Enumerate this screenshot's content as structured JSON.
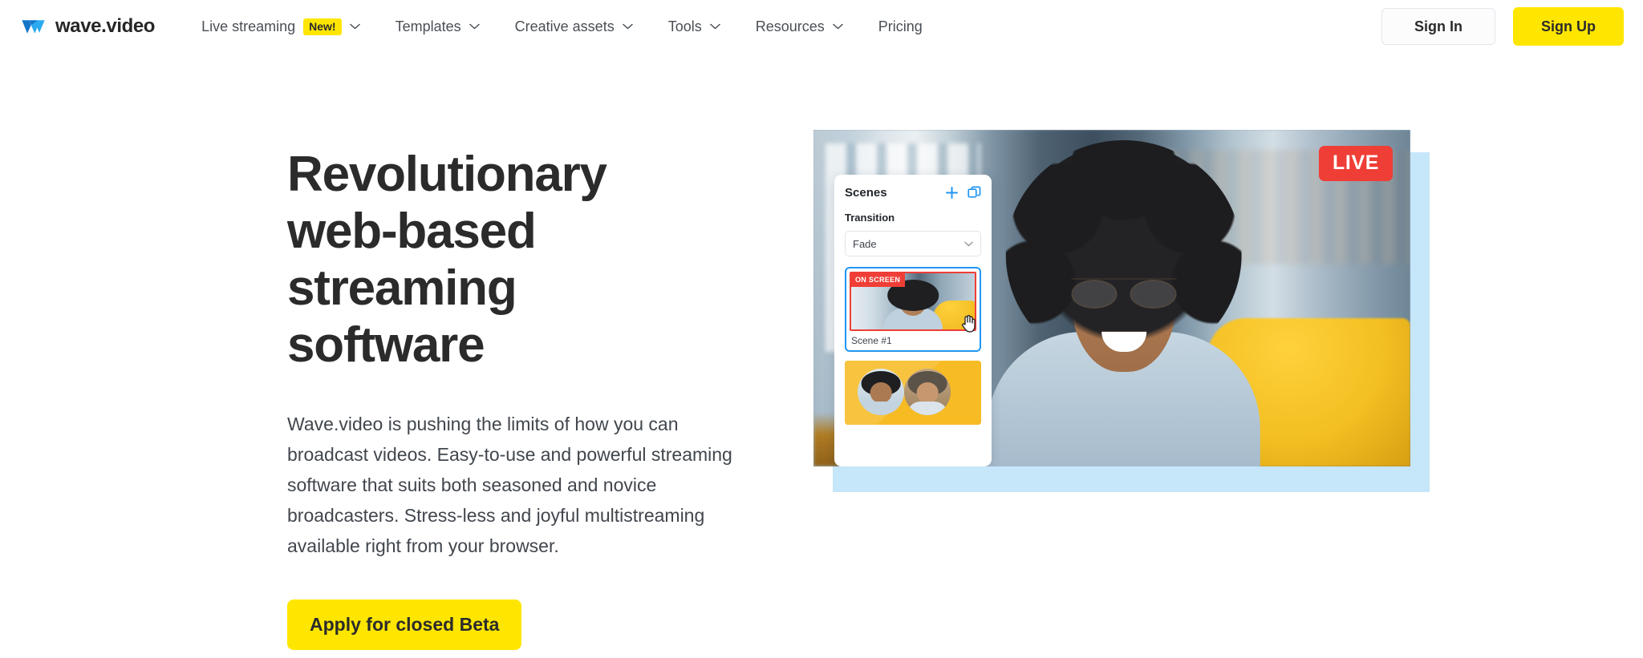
{
  "header": {
    "brand": {
      "name": "wave.video",
      "logo_icon": "wave-w-logo-icon",
      "logo_color_dark": "#1376c9",
      "logo_color_light": "#2aa9f0"
    },
    "nav": [
      {
        "label": "Live streaming",
        "badge": "New!",
        "has_dropdown": true
      },
      {
        "label": "Templates",
        "badge": null,
        "has_dropdown": true
      },
      {
        "label": "Creative assets",
        "badge": null,
        "has_dropdown": true
      },
      {
        "label": "Tools",
        "badge": null,
        "has_dropdown": true
      },
      {
        "label": "Resources",
        "badge": null,
        "has_dropdown": true
      },
      {
        "label": "Pricing",
        "badge": null,
        "has_dropdown": false
      }
    ],
    "sign_in_label": "Sign In",
    "sign_up_label": "Sign Up",
    "accent_yellow": "#ffe600"
  },
  "hero": {
    "title": "Revolutionary web-based streaming software",
    "description": "Wave.video is pushing the limits of how you can broadcast videos. Easy-to-use and powerful streaming software that suits both seasoned and novice broadcasters. Stress-less and joyful multistreaming available right from your browser.",
    "cta_label": "Apply for closed Beta",
    "accent_block_color": "#c6e6fa"
  },
  "visual": {
    "live_badge": "LIVE",
    "live_badge_color": "#ef3e36",
    "panel": {
      "title": "Scenes",
      "add_icon": "plus-icon",
      "duplicate_icon": "duplicate-icon",
      "transition_label": "Transition",
      "transition_value": "Fade",
      "scenes": [
        {
          "name": "Scene #1",
          "status_badge": "ON SCREEN",
          "selected": true
        },
        {
          "name": "",
          "status_badge": null,
          "selected": false
        }
      ]
    },
    "cursor_icon": "pointing-hand-cursor-icon",
    "selected_outline_color": "#2196f3"
  }
}
